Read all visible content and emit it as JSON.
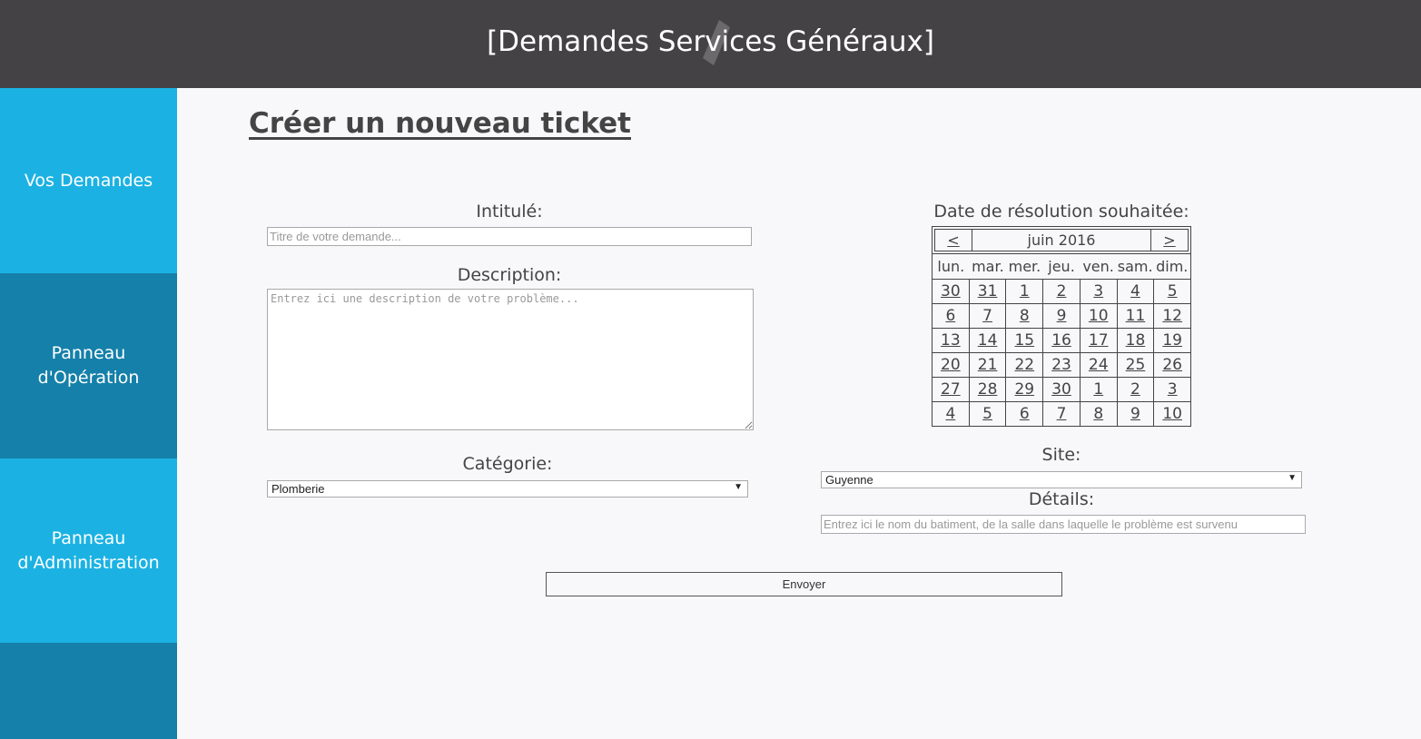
{
  "header": {
    "title": "[Demandes Services Généraux]"
  },
  "sidebar": {
    "items": [
      {
        "label": "Vos Demandes"
      },
      {
        "label": "Panneau d'Opération"
      },
      {
        "label": "Panneau d'Administration"
      }
    ]
  },
  "page": {
    "title": "Créer un nouveau ticket"
  },
  "form": {
    "intitule_label": "Intitulé:",
    "intitule_placeholder": "Titre de votre demande...",
    "intitule_value": "",
    "description_label": "Description:",
    "description_placeholder": "Entrez ici une description de votre problème...",
    "description_value": "",
    "categorie_label": "Catégorie:",
    "categorie_value": "Plomberie",
    "date_label": "Date de résolution souhaitée:",
    "site_label": "Site:",
    "site_value": "Guyenne",
    "details_label": "Détails:",
    "details_placeholder": "Entrez ici le nom du batiment, de la salle dans laquelle le problème est survenu",
    "details_value": "",
    "submit_label": "Envoyer"
  },
  "calendar": {
    "prev": "<",
    "next": ">",
    "month": "juin 2016",
    "weekdays": [
      "lun.",
      "mar.",
      "mer.",
      "jeu.",
      "ven.",
      "sam.",
      "dim."
    ],
    "weeks": [
      [
        "30",
        "31",
        "1",
        "2",
        "3",
        "4",
        "5"
      ],
      [
        "6",
        "7",
        "8",
        "9",
        "10",
        "11",
        "12"
      ],
      [
        "13",
        "14",
        "15",
        "16",
        "17",
        "18",
        "19"
      ],
      [
        "20",
        "21",
        "22",
        "23",
        "24",
        "25",
        "26"
      ],
      [
        "27",
        "28",
        "29",
        "30",
        "1",
        "2",
        "3"
      ],
      [
        "4",
        "5",
        "6",
        "7",
        "8",
        "9",
        "10"
      ]
    ]
  },
  "colors": {
    "header_bg": "#454246",
    "sidebar_light": "#1bb2e3",
    "sidebar_dark": "#1580a9",
    "page_bg": "#f8f7fa"
  }
}
